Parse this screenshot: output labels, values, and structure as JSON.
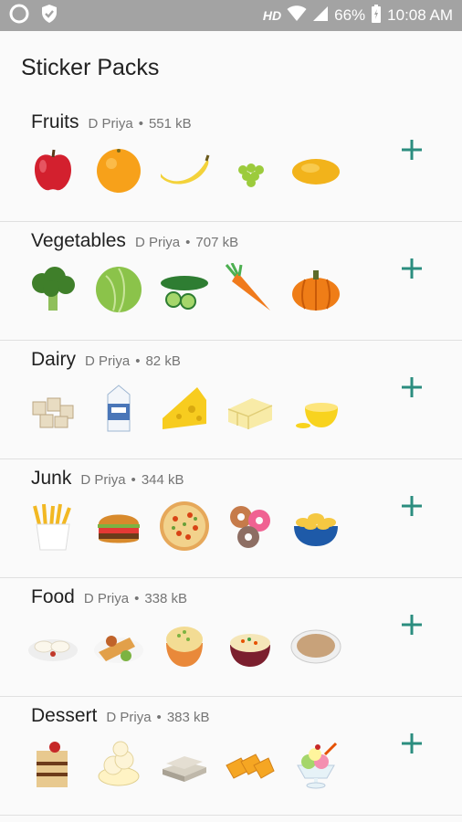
{
  "status_bar": {
    "network": "HD",
    "battery": "66%",
    "time": "10:08 AM"
  },
  "app": {
    "title": "Sticker Packs"
  },
  "packs": [
    {
      "name": "Fruits",
      "author": "D Priya",
      "size": "551 kB"
    },
    {
      "name": "Vegetables",
      "author": "D Priya",
      "size": "707 kB"
    },
    {
      "name": "Dairy",
      "author": "D Priya",
      "size": "82 kB"
    },
    {
      "name": "Junk",
      "author": "D Priya",
      "size": "344 kB"
    },
    {
      "name": "Food",
      "author": "D Priya",
      "size": "338 kB"
    },
    {
      "name": "Dessert",
      "author": "D Priya",
      "size": "383 kB"
    }
  ],
  "colors": {
    "accent": "#2b8d7f",
    "status_bar": "#a3a3a3",
    "divider": "#e0e0e0"
  },
  "icons": {
    "add": "plus-icon"
  }
}
